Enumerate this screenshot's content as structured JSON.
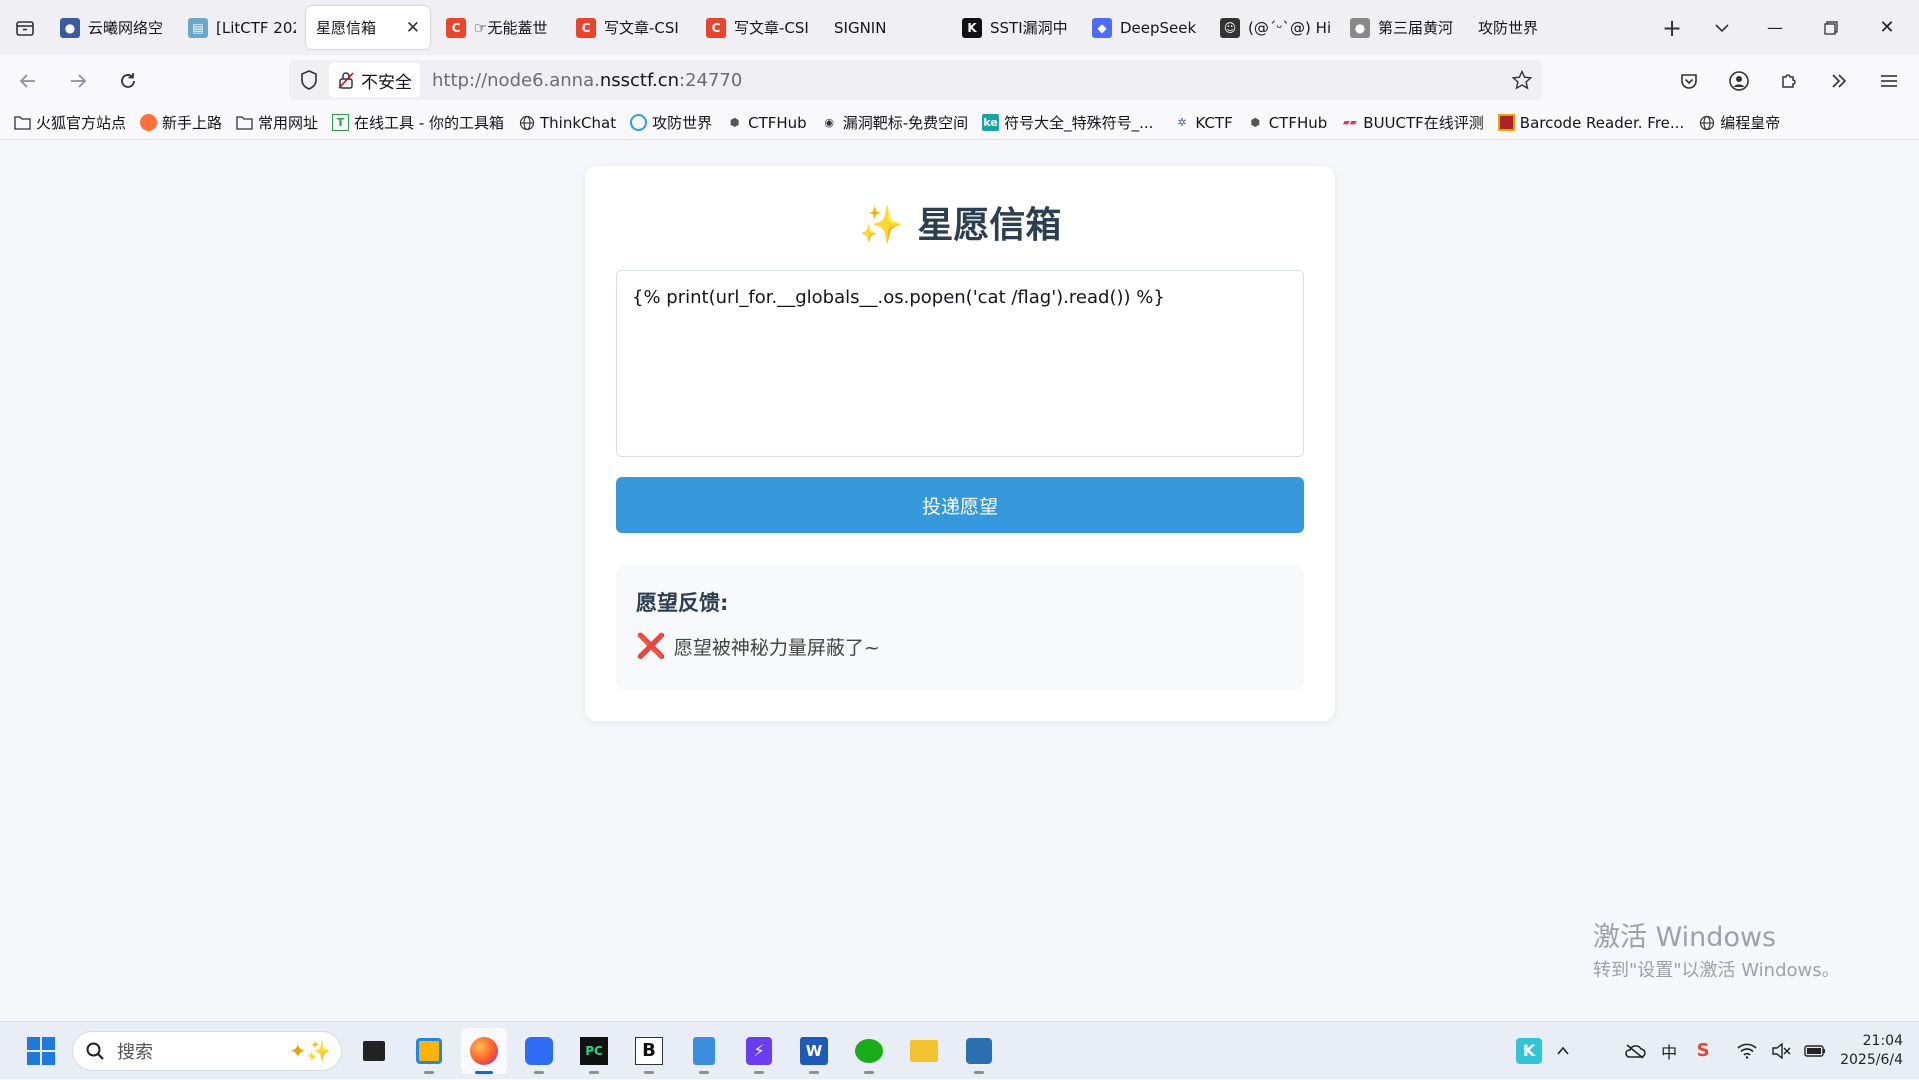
{
  "browser": {
    "tabs": [
      {
        "label": "云曦网络空",
        "icon_color": "#3a5ba0",
        "icon": "cloud-icon"
      },
      {
        "label": "[LitCTF 202",
        "icon_color": "#6aa7c8",
        "icon": "page-icon"
      },
      {
        "label": "星愿信箱",
        "active": true,
        "icon": ""
      },
      {
        "label": "☞无能蓋世",
        "icon_color": "#e8452c",
        "icon": "csdn-icon"
      },
      {
        "label": "写文章-CSI",
        "icon_color": "#e8452c",
        "icon": "csdn-icon"
      },
      {
        "label": "写文章-CSI",
        "icon_color": "#e8452c",
        "icon": "csdn-icon"
      },
      {
        "label": "SIGNIN",
        "icon": ""
      },
      {
        "label": "SSTI漏洞中",
        "icon_color": "#111111",
        "icon": "k-icon"
      },
      {
        "label": "DeepSeek",
        "icon_color": "#4d6bfe",
        "icon": "deepseek-icon"
      },
      {
        "label": "(@´ᵕ`@) Hi",
        "icon_color": "#333333",
        "icon": "avatar-icon"
      },
      {
        "label": "第三届黄河",
        "icon_color": "#888888",
        "icon": "mic-icon"
      },
      {
        "label": "攻防世界",
        "icon": ""
      }
    ],
    "security_label": "不安全",
    "url_prefix": "http://node6.anna.",
    "url_domain": "nssctf.cn",
    "url_suffix": ":24770",
    "bookmarks": [
      {
        "label": "火狐官方站点",
        "icon": "folder-icon"
      },
      {
        "label": "新手上路",
        "icon": "firefox-icon"
      },
      {
        "label": "常用网址",
        "icon": "folder-icon"
      },
      {
        "label": "在线工具 - 你的工具箱",
        "icon": "tools-icon"
      },
      {
        "label": "ThinkChat",
        "icon": "globe-icon"
      },
      {
        "label": "攻防世界",
        "icon": "adworld-icon"
      },
      {
        "label": "CTFHub",
        "icon": "ctfhub-icon"
      },
      {
        "label": "漏洞靶标-免费空间",
        "icon": "vuln-icon"
      },
      {
        "label": "符号大全_特殊符号_...",
        "icon": "ke-icon"
      },
      {
        "label": "KCTF",
        "icon": "kctf-icon"
      },
      {
        "label": "CTFHub",
        "icon": "ctfhub-icon"
      },
      {
        "label": "BUUCTF在线评测",
        "icon": "buu-icon"
      },
      {
        "label": "Barcode Reader. Fre...",
        "icon": "barcode-icon"
      },
      {
        "label": "编程皇帝",
        "icon": "globe-icon"
      }
    ]
  },
  "page": {
    "title_icon": "✨",
    "title": "星愿信箱",
    "textarea_value": "{% print(url_for.__globals__.os.popen('cat /flag').read()) %}",
    "submit_label": "投递愿望",
    "feedback_title": "愿望反馈:",
    "feedback_icon": "❌",
    "feedback_message": "愿望被神秘力量屏蔽了~",
    "accent_color": "#3498db"
  },
  "watermark": {
    "line1": "激活 Windows",
    "line2": "转到\"设置\"以激活 Windows。"
  },
  "taskbar": {
    "search_placeholder": "搜索",
    "time": "21:04",
    "date": "2025/6/4",
    "ime": "中"
  }
}
